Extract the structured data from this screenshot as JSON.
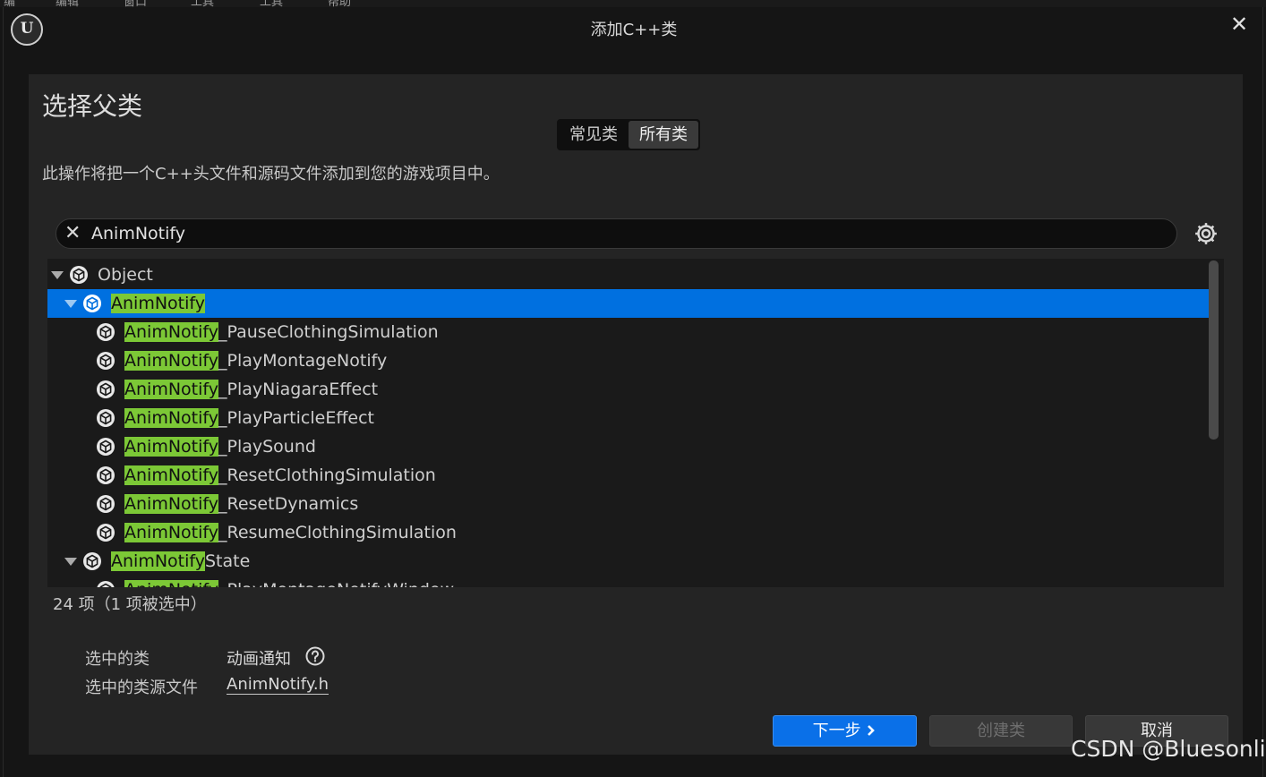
{
  "top_menu": [
    "编",
    "编辑",
    "窗口",
    "工具",
    "工具",
    "帮助"
  ],
  "window": {
    "logo_text": "U",
    "title": "添加C++类",
    "close_glyph": "✕"
  },
  "dialog": {
    "heading": "选择父类",
    "tabs": [
      {
        "label": "常见类",
        "active": false
      },
      {
        "label": "所有类",
        "active": true
      }
    ],
    "description": "此操作将把一个C++头文件和源码文件添加到您的游戏项目中。",
    "search": {
      "value": "AnimNotify",
      "clear_glyph": "✕"
    }
  },
  "tree": {
    "rows": [
      {
        "match": "",
        "rest": "Object",
        "expanded": true,
        "selected": false
      },
      {
        "match": "AnimNotify",
        "rest": "",
        "expanded": true,
        "selected": true
      },
      {
        "match": "AnimNotify",
        "rest": "_PauseClothingSimulation",
        "expanded": false,
        "selected": false
      },
      {
        "match": "AnimNotify",
        "rest": "_PlayMontageNotify",
        "expanded": false,
        "selected": false
      },
      {
        "match": "AnimNotify",
        "rest": "_PlayNiagaraEffect",
        "expanded": false,
        "selected": false
      },
      {
        "match": "AnimNotify",
        "rest": "_PlayParticleEffect",
        "expanded": false,
        "selected": false
      },
      {
        "match": "AnimNotify",
        "rest": "_PlaySound",
        "expanded": false,
        "selected": false
      },
      {
        "match": "AnimNotify",
        "rest": "_ResetClothingSimulation",
        "expanded": false,
        "selected": false
      },
      {
        "match": "AnimNotify",
        "rest": "_ResetDynamics",
        "expanded": false,
        "selected": false
      },
      {
        "match": "AnimNotify",
        "rest": "_ResumeClothingSimulation",
        "expanded": false,
        "selected": false
      },
      {
        "match": "AnimNotify",
        "rest": "State",
        "expanded": true,
        "selected": false
      },
      {
        "match": "AnimNotify",
        "rest": "_PlayMontageNotifyWindow",
        "expanded": false,
        "selected": false
      }
    ]
  },
  "status": {
    "count_text": "24 项（1 项被选中）"
  },
  "selection": {
    "class_label": "选中的类",
    "class_value": "动画通知",
    "file_label": "选中的类源文件",
    "file_value": "AnimNotify.h"
  },
  "buttons": {
    "next": "下一步",
    "create": "创建类",
    "cancel": "取消"
  },
  "watermark": "CSDN @Bluesonli",
  "colors": {
    "selection": "#0070e0",
    "match_highlight": "#7cc836",
    "primary_button": "#0a70e8"
  }
}
